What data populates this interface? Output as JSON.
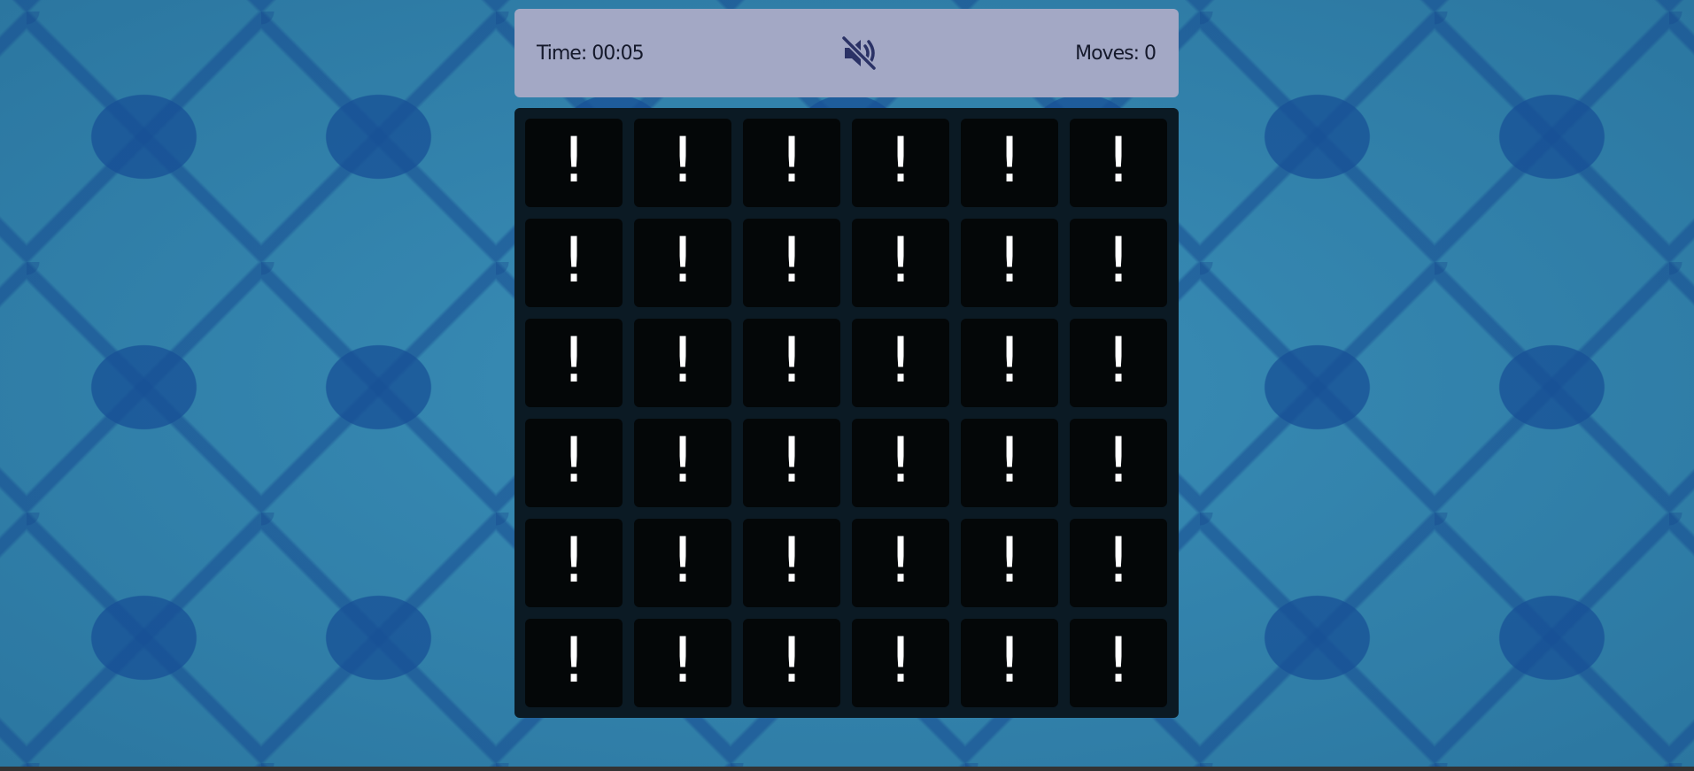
{
  "hud": {
    "time_label": "Time:",
    "time_value": "00:05",
    "moves_label": "Moves:",
    "moves_value": "0",
    "sound_icon": "speaker-muted-icon"
  },
  "board": {
    "rows": 6,
    "cols": 6,
    "cards": [
      "!",
      "!",
      "!",
      "!",
      "!",
      "!",
      "!",
      "!",
      "!",
      "!",
      "!",
      "!",
      "!",
      "!",
      "!",
      "!",
      "!",
      "!",
      "!",
      "!",
      "!",
      "!",
      "!",
      "!",
      "!",
      "!",
      "!",
      "!",
      "!",
      "!",
      "!",
      "!",
      "!",
      "!",
      "!",
      "!"
    ]
  },
  "colors": {
    "hud_bg": "#a3a8c5",
    "board_bg": "#0b1a24",
    "card_bg": "#040708",
    "card_text": "#ffffff",
    "wallpaper": "#2e7ea6"
  }
}
